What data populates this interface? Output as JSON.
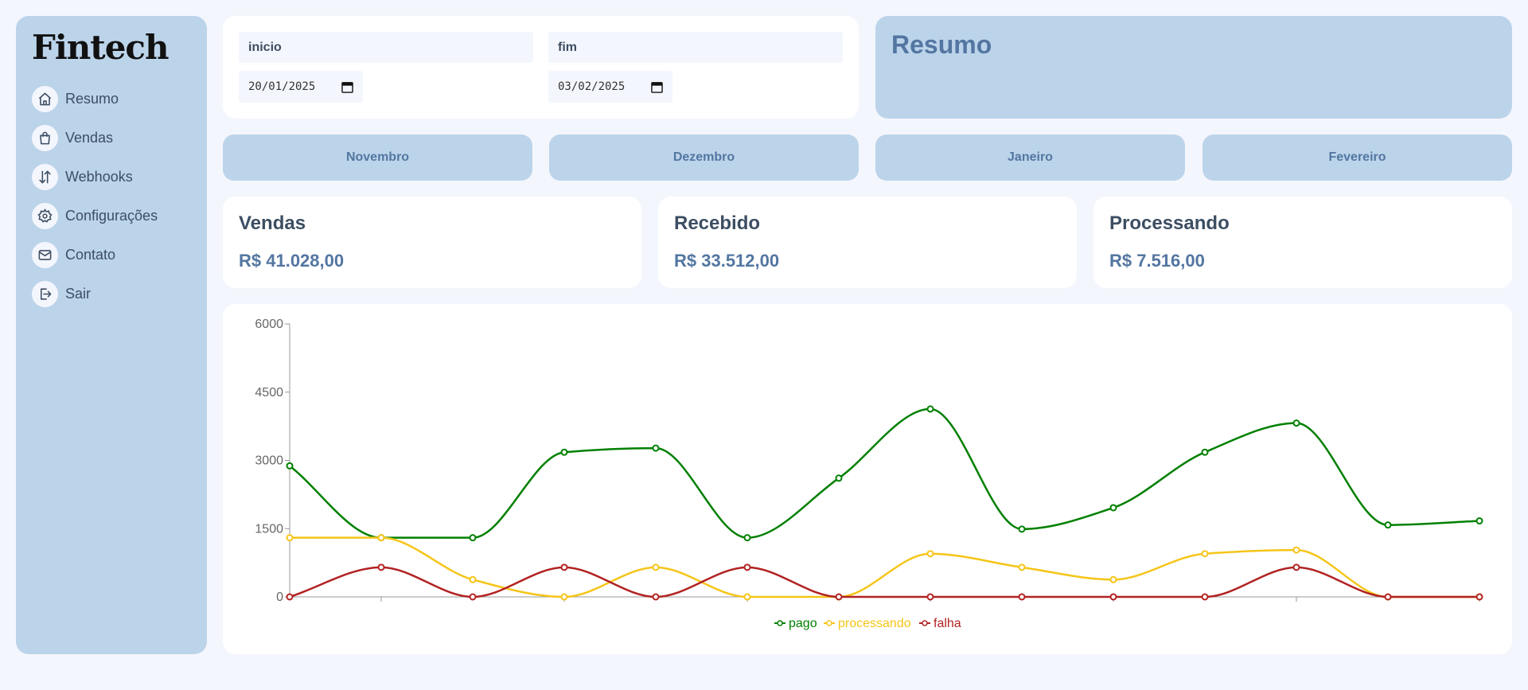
{
  "app": {
    "logo": "Fintech"
  },
  "sidebar": {
    "items": [
      {
        "label": "Resumo",
        "icon": "home-icon"
      },
      {
        "label": "Vendas",
        "icon": "shopping-bag-icon"
      },
      {
        "label": "Webhooks",
        "icon": "arrows-up-down-icon"
      },
      {
        "label": "Configurações",
        "icon": "gear-icon"
      },
      {
        "label": "Contato",
        "icon": "mail-icon"
      },
      {
        "label": "Sair",
        "icon": "logout-icon"
      }
    ]
  },
  "filters": {
    "start": {
      "label": "inicio",
      "value": "20/01/2025"
    },
    "end": {
      "label": "fim",
      "value": "03/02/2025"
    }
  },
  "header": {
    "title": "Resumo"
  },
  "months": [
    "Novembro",
    "Dezembro",
    "Janeiro",
    "Fevereiro"
  ],
  "stats": [
    {
      "title": "Vendas",
      "value": "R$ 41.028,00"
    },
    {
      "title": "Recebido",
      "value": "R$ 33.512,00"
    },
    {
      "title": "Processando",
      "value": "R$ 7.516,00"
    }
  ],
  "colors": {
    "sidebar_bg": "#bcd4ea",
    "accent": "#5376a1",
    "pago": "#008000",
    "processando": "#f5c518",
    "falha": "#b22222"
  },
  "chart_data": {
    "type": "line",
    "x": [
      0,
      1,
      2,
      3,
      4,
      5,
      6,
      7,
      8,
      9,
      10,
      11,
      12,
      13
    ],
    "ylim": [
      0,
      6000
    ],
    "yticks": [
      "0",
      "1500",
      "3000",
      "4500",
      "6000"
    ],
    "grid": false,
    "legend": "bottom-center",
    "series": [
      {
        "name": "pago",
        "color": "#008000",
        "values": [
          2880,
          1300,
          1300,
          3180,
          3270,
          1300,
          2610,
          4130,
          1490,
          1960,
          3180,
          3820,
          1580,
          1670
        ]
      },
      {
        "name": "processando",
        "color": "#f5c518",
        "values": [
          1300,
          1300,
          380,
          0,
          650,
          0,
          0,
          950,
          650,
          380,
          950,
          1030,
          0,
          0
        ]
      },
      {
        "name": "falha",
        "color": "#b22222",
        "values": [
          0,
          650,
          0,
          650,
          0,
          650,
          0,
          0,
          0,
          0,
          0,
          650,
          0,
          0
        ]
      }
    ]
  }
}
